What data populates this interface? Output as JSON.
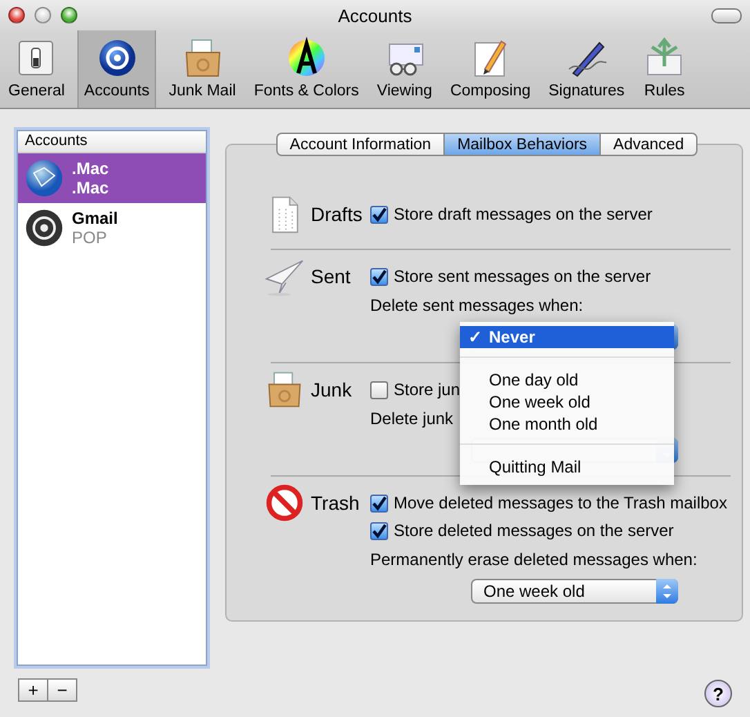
{
  "window": {
    "title": "Accounts"
  },
  "toolbar": {
    "items": [
      {
        "label": "General",
        "selected": false
      },
      {
        "label": "Accounts",
        "selected": true
      },
      {
        "label": "Junk Mail",
        "selected": false
      },
      {
        "label": "Fonts & Colors",
        "selected": false
      },
      {
        "label": "Viewing",
        "selected": false
      },
      {
        "label": "Composing",
        "selected": false
      },
      {
        "label": "Signatures",
        "selected": false
      },
      {
        "label": "Rules",
        "selected": false
      }
    ]
  },
  "accounts": {
    "header": "Accounts",
    "items": [
      {
        "name": ".Mac",
        "type": ".Mac",
        "selected": true
      },
      {
        "name": "Gmail",
        "type": "POP",
        "selected": false
      }
    ],
    "buttons": [
      "+",
      "−"
    ]
  },
  "tabs": [
    {
      "label": "Account Information",
      "selected": false
    },
    {
      "label": "Mailbox Behaviors",
      "selected": true
    },
    {
      "label": "Advanced",
      "selected": false
    }
  ],
  "sections": [
    {
      "label": "Drafts",
      "rows": [
        {
          "kind": "checkbox",
          "label": "Store draft messages on the server",
          "checked": true
        }
      ]
    },
    {
      "label": "Sent",
      "rows": [
        {
          "kind": "checkbox",
          "label": "Store sent messages on the server",
          "checked": true
        },
        {
          "kind": "caption",
          "text": "Delete sent messages when:"
        },
        {
          "kind": "popup"
        }
      ]
    },
    {
      "label": "Junk",
      "rows": [
        {
          "kind": "checkbox",
          "label": "Store jun",
          "checked": false
        },
        {
          "kind": "caption",
          "text": "Delete junk"
        },
        {
          "kind": "popup"
        }
      ]
    },
    {
      "label": "Trash",
      "rows": [
        {
          "kind": "checkbox",
          "label": "Move deleted messages to the Trash mailbox",
          "checked": true
        },
        {
          "kind": "checkbox",
          "label": "Store deleted messages on the server",
          "checked": true
        },
        {
          "kind": "caption",
          "text": "Permanently erase deleted messages when:"
        },
        {
          "kind": "popup",
          "value": "One week old"
        }
      ]
    }
  ],
  "menu": {
    "mark": "✓",
    "items": [
      {
        "kind": "option",
        "label": "Never",
        "selected": true
      },
      {
        "kind": "separator"
      },
      {
        "kind": "option",
        "label": "One day old",
        "selected": false
      },
      {
        "kind": "option",
        "label": "One week old",
        "selected": false
      },
      {
        "kind": "option",
        "label": "One month old",
        "selected": false
      },
      {
        "kind": "separator"
      },
      {
        "kind": "option",
        "label": "Quitting Mail",
        "selected": false
      }
    ]
  },
  "help": "?"
}
